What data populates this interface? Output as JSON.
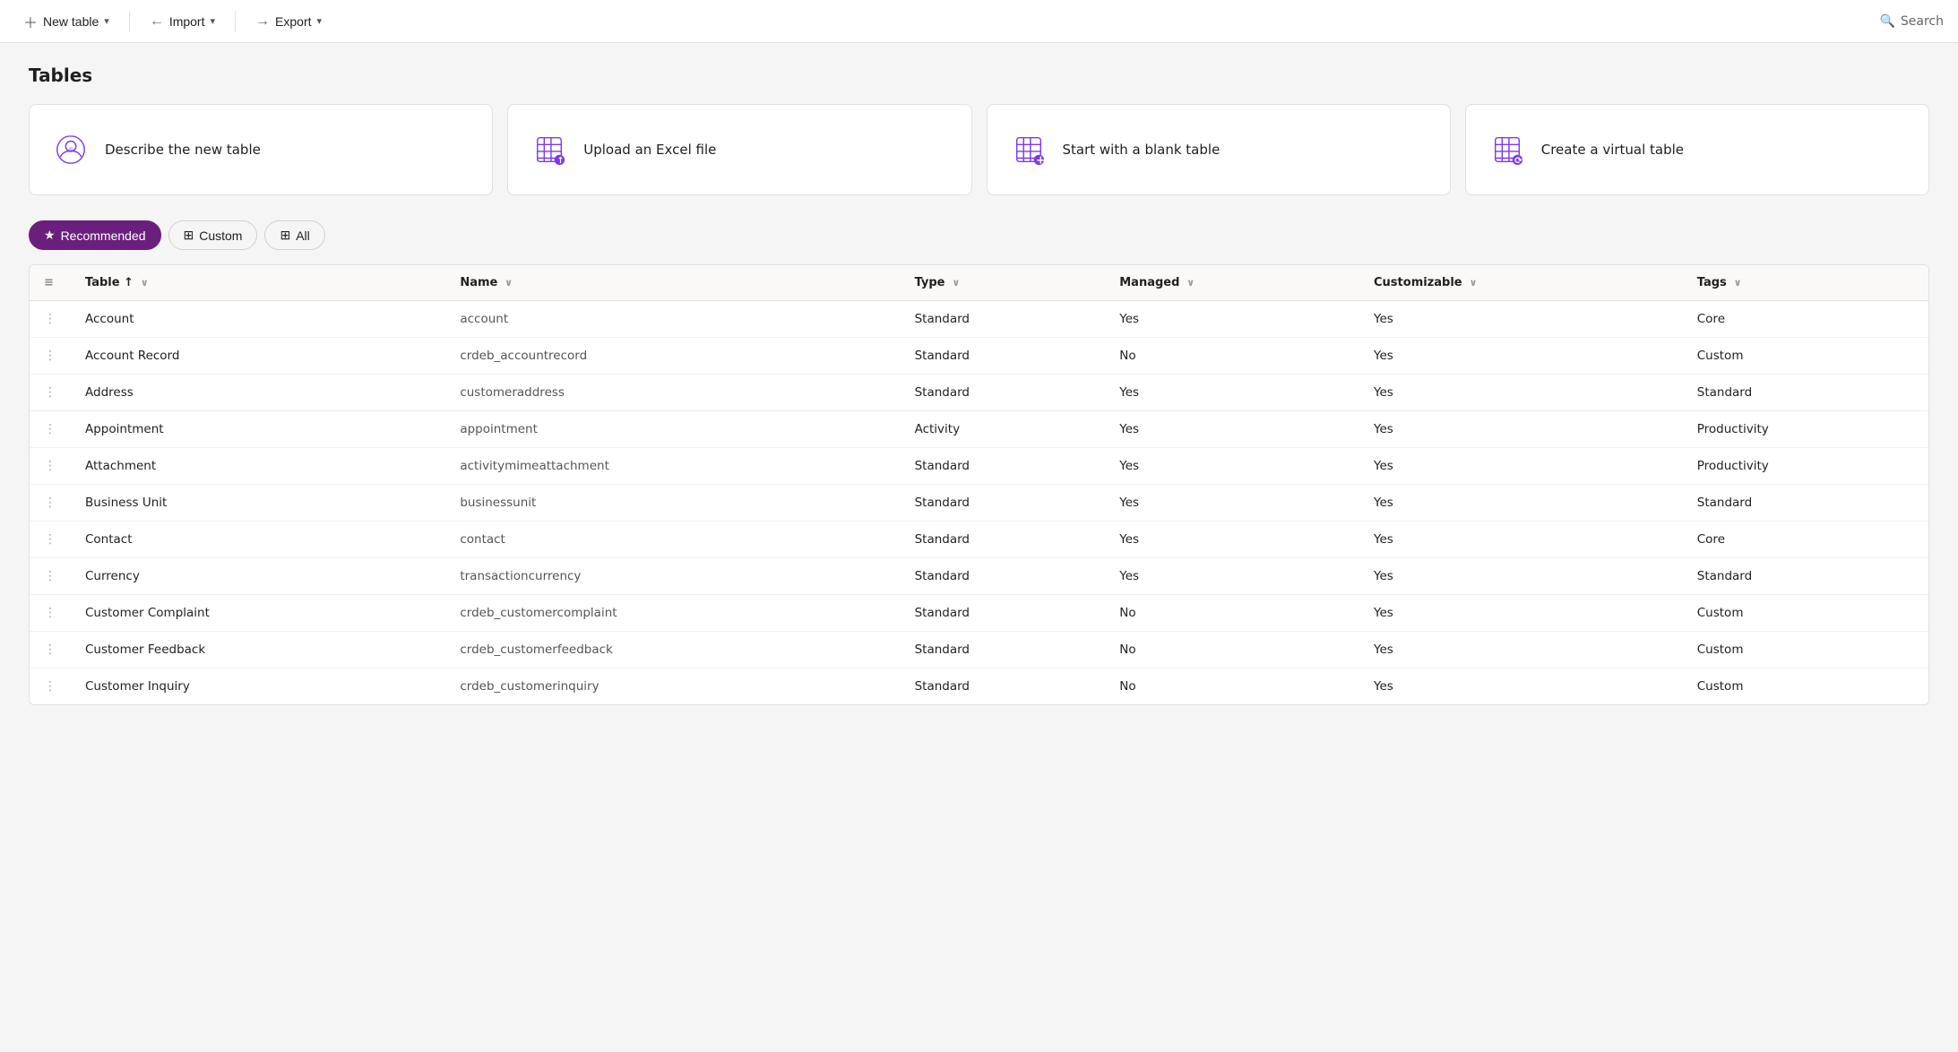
{
  "toolbar": {
    "new_table_label": "New table",
    "import_label": "Import",
    "export_label": "Export",
    "search_label": "Search"
  },
  "page": {
    "title": "Tables"
  },
  "cards": [
    {
      "id": "describe",
      "label": "Describe the new table",
      "icon": "ai"
    },
    {
      "id": "upload",
      "label": "Upload an Excel file",
      "icon": "excel"
    },
    {
      "id": "blank",
      "label": "Start with a blank table",
      "icon": "blank"
    },
    {
      "id": "virtual",
      "label": "Create a virtual table",
      "icon": "virtual"
    }
  ],
  "filters": [
    {
      "id": "recommended",
      "label": "Recommended",
      "active": true,
      "icon": "star"
    },
    {
      "id": "custom",
      "label": "Custom",
      "active": false,
      "icon": "grid"
    },
    {
      "id": "all",
      "label": "All",
      "active": false,
      "icon": "grid"
    }
  ],
  "table": {
    "columns": [
      {
        "id": "table",
        "label": "Table",
        "sortable": true
      },
      {
        "id": "name",
        "label": "Name",
        "sortable": true
      },
      {
        "id": "type",
        "label": "Type",
        "sortable": true
      },
      {
        "id": "managed",
        "label": "Managed",
        "sortable": true
      },
      {
        "id": "customizable",
        "label": "Customizable",
        "sortable": true
      },
      {
        "id": "tags",
        "label": "Tags",
        "sortable": true
      }
    ],
    "rows": [
      {
        "table": "Account",
        "name": "account",
        "type": "Standard",
        "managed": "Yes",
        "customizable": "Yes",
        "tags": "Core"
      },
      {
        "table": "Account Record",
        "name": "crdeb_accountrecord",
        "type": "Standard",
        "managed": "No",
        "customizable": "Yes",
        "tags": "Custom"
      },
      {
        "table": "Address",
        "name": "customeraddress",
        "type": "Standard",
        "managed": "Yes",
        "customizable": "Yes",
        "tags": "Standard"
      },
      {
        "table": "Appointment",
        "name": "appointment",
        "type": "Activity",
        "managed": "Yes",
        "customizable": "Yes",
        "tags": "Productivity"
      },
      {
        "table": "Attachment",
        "name": "activitymimeattachment",
        "type": "Standard",
        "managed": "Yes",
        "customizable": "Yes",
        "tags": "Productivity"
      },
      {
        "table": "Business Unit",
        "name": "businessunit",
        "type": "Standard",
        "managed": "Yes",
        "customizable": "Yes",
        "tags": "Standard"
      },
      {
        "table": "Contact",
        "name": "contact",
        "type": "Standard",
        "managed": "Yes",
        "customizable": "Yes",
        "tags": "Core"
      },
      {
        "table": "Currency",
        "name": "transactioncurrency",
        "type": "Standard",
        "managed": "Yes",
        "customizable": "Yes",
        "tags": "Standard"
      },
      {
        "table": "Customer Complaint",
        "name": "crdeb_customercomplaint",
        "type": "Standard",
        "managed": "No",
        "customizable": "Yes",
        "tags": "Custom"
      },
      {
        "table": "Customer Feedback",
        "name": "crdeb_customerfeedback",
        "type": "Standard",
        "managed": "No",
        "customizable": "Yes",
        "tags": "Custom"
      },
      {
        "table": "Customer Inquiry",
        "name": "crdeb_customerinquiry",
        "type": "Standard",
        "managed": "No",
        "customizable": "Yes",
        "tags": "Custom"
      }
    ]
  }
}
